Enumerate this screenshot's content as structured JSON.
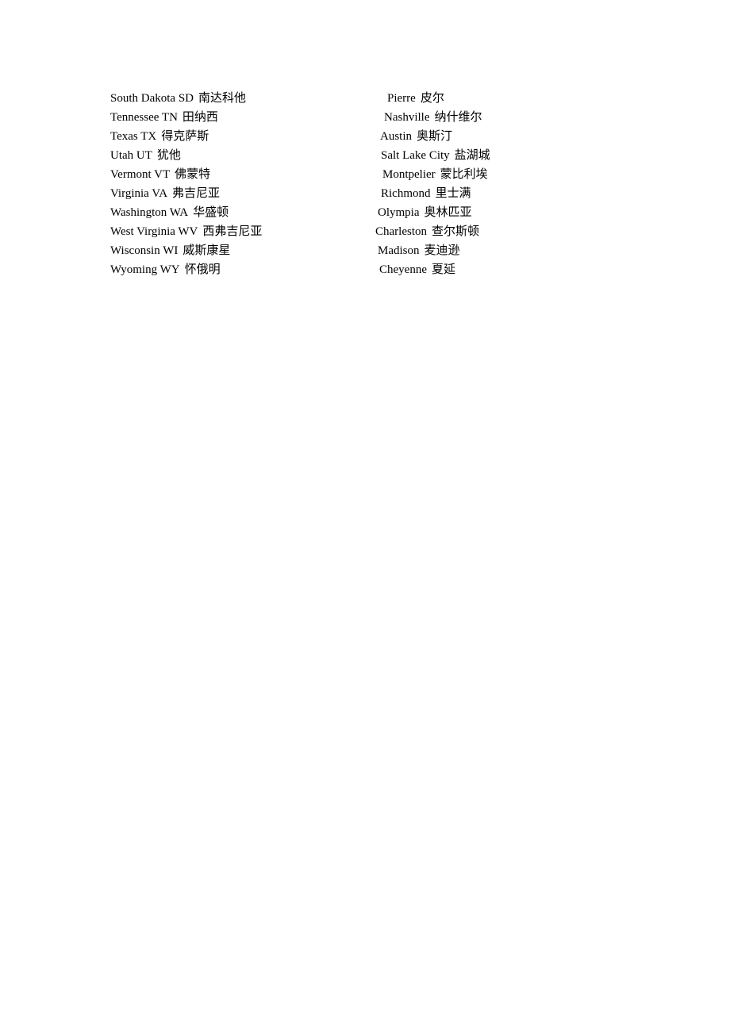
{
  "document": {
    "rows": [
      {
        "state": "South Dakota SD",
        "state_cn": "南达科他",
        "capital": "Pierre",
        "capital_cn": "皮尔"
      },
      {
        "state": "Tennessee TN",
        "state_cn": "田纳西",
        "capital": "Nashville",
        "capital_cn": "纳什维尔"
      },
      {
        "state": "Texas TX",
        "state_cn": "得克萨斯",
        "capital": "Austin",
        "capital_cn": "奥斯汀"
      },
      {
        "state": "Utah UT",
        "state_cn": "犹他",
        "capital": "Salt Lake City",
        "capital_cn": "盐湖城"
      },
      {
        "state": "Vermont VT",
        "state_cn": "佛蒙特",
        "capital": "Montpelier",
        "capital_cn": "蒙比利埃"
      },
      {
        "state": "Virginia VA",
        "state_cn": "弗吉尼亚",
        "capital": "Richmond",
        "capital_cn": "里士满"
      },
      {
        "state": "Washington WA",
        "state_cn": "华盛顿",
        "capital": "Olympia",
        "capital_cn": "奥林匹亚"
      },
      {
        "state": "West Virginia WV",
        "state_cn": "西弗吉尼亚",
        "capital": "Charleston",
        "capital_cn": "查尔斯顿"
      },
      {
        "state": "Wisconsin WI",
        "state_cn": "威斯康星",
        "capital": "Madison",
        "capital_cn": "麦迪逊"
      },
      {
        "state": "Wyoming WY",
        "state_cn": "怀俄明",
        "capital": "Cheyenne",
        "capital_cn": "夏延"
      }
    ]
  }
}
